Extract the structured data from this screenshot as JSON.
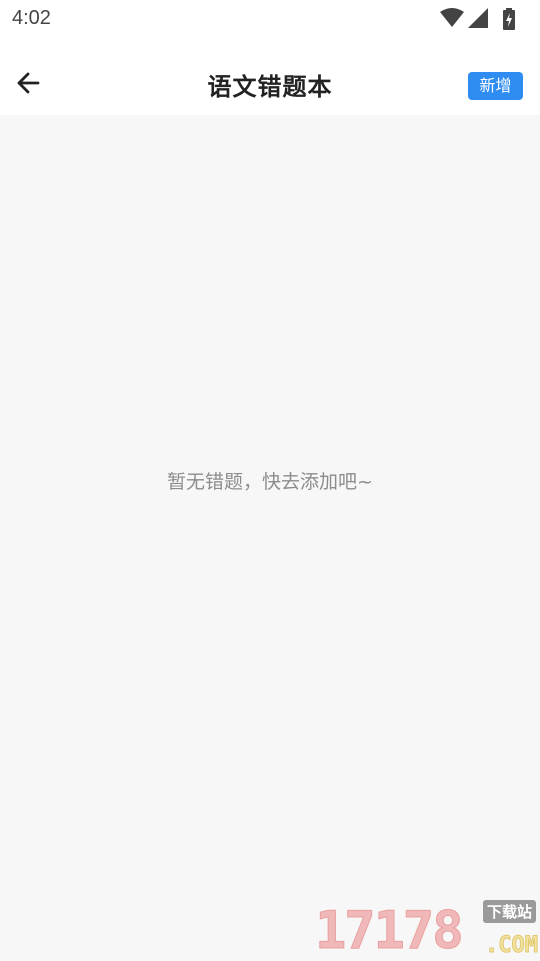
{
  "status_bar": {
    "time": "4:02",
    "icons": [
      "wifi-icon",
      "cell-signal-icon",
      "battery-charging-icon"
    ]
  },
  "app_bar": {
    "back_icon": "arrow-left-icon",
    "title": "语文错题本",
    "add_label": "新增",
    "accent_color": "#2f8cf0"
  },
  "content": {
    "empty_message": "暂无错题，快去添加吧~"
  },
  "watermark": {
    "digits": "17178",
    "site_label": "下载站",
    "domain_suffix": ".COM"
  }
}
